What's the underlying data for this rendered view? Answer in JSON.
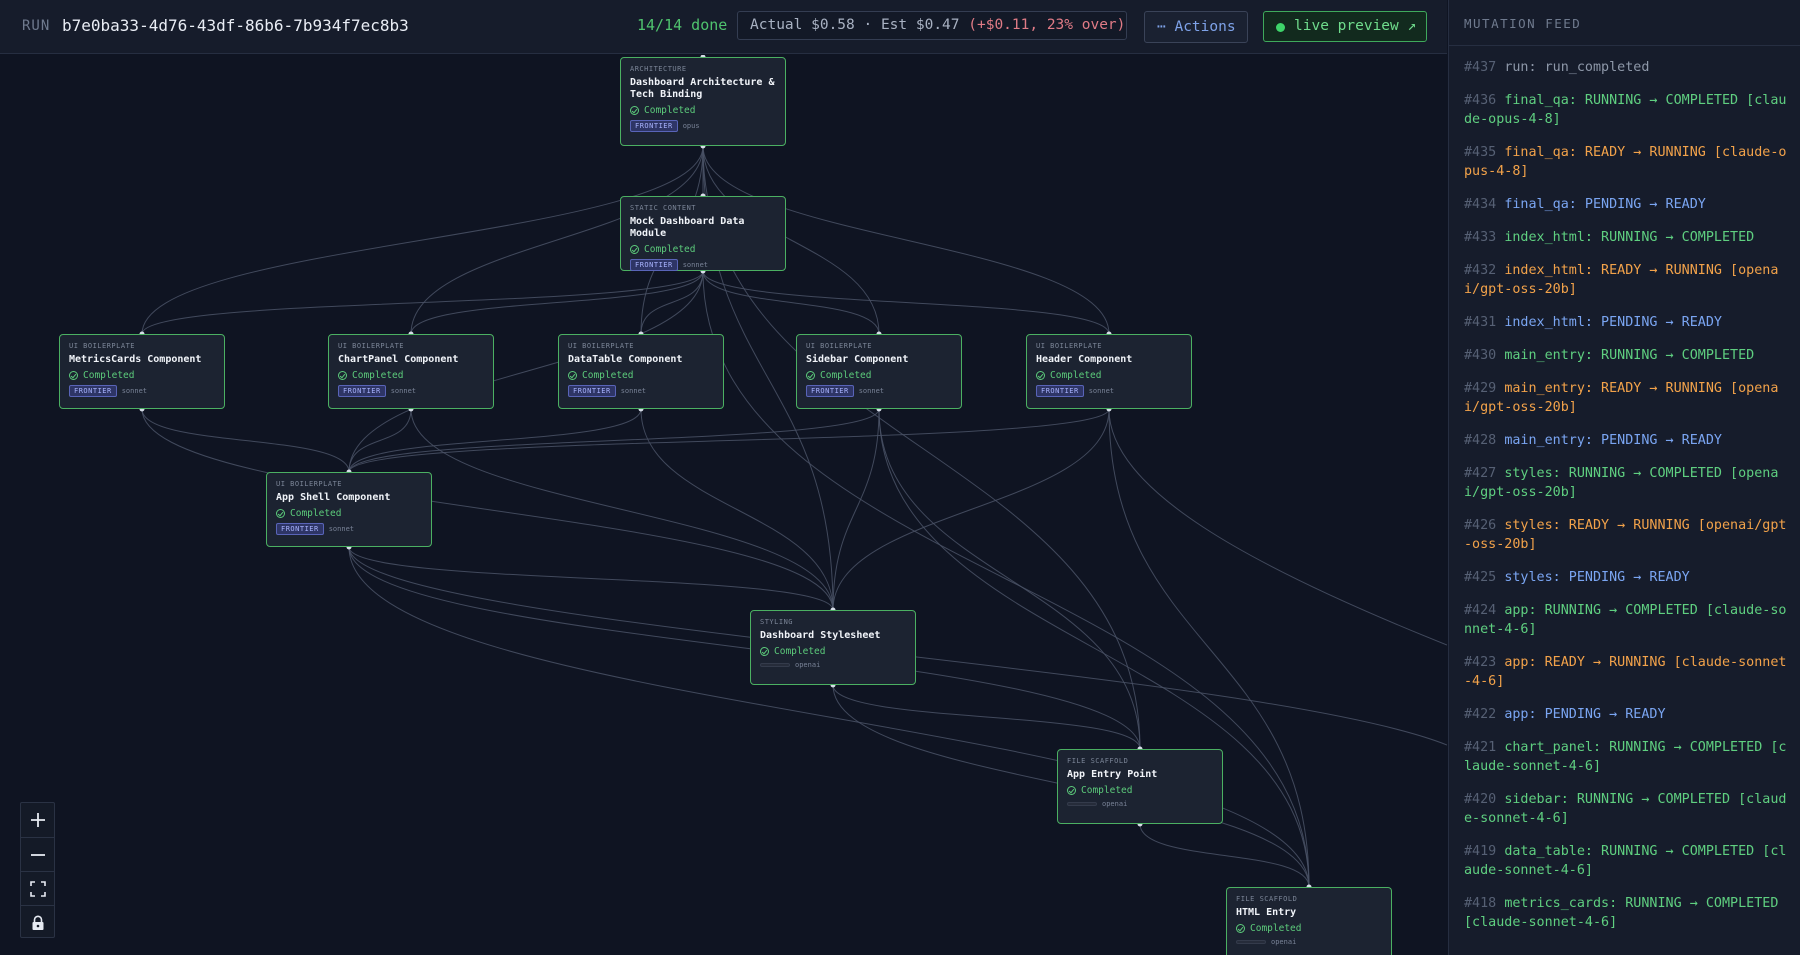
{
  "header": {
    "run_label": "RUN",
    "run_id": "b7e0ba33-4d76-43df-86b6-7b934f7ec8b3",
    "progress": "14/14 done",
    "cost_base": "Actual $0.58 · Est $0.47",
    "cost_over": "(+$0.11, 23% over)",
    "actions_label": "⋯ Actions",
    "live_preview_label": "live preview ↗"
  },
  "nodes": [
    {
      "id": "architecture",
      "category": "ARCHITECTURE",
      "title": "Dashboard Architecture & Tech Binding",
      "status": "Completed",
      "tier": "FRONTIER",
      "model": "opus"
    },
    {
      "id": "mock_data",
      "category": "STATIC CONTENT",
      "title": "Mock Dashboard Data Module",
      "status": "Completed",
      "tier": "FRONTIER",
      "model": "sonnet"
    },
    {
      "id": "metrics_cards",
      "category": "UI BOILERPLATE",
      "title": "MetricsCards Component",
      "status": "Completed",
      "tier": "FRONTIER",
      "model": "sonnet"
    },
    {
      "id": "chart_panel",
      "category": "UI BOILERPLATE",
      "title": "ChartPanel Component",
      "status": "Completed",
      "tier": "FRONTIER",
      "model": "sonnet"
    },
    {
      "id": "data_table",
      "category": "UI BOILERPLATE",
      "title": "DataTable Component",
      "status": "Completed",
      "tier": "FRONTIER",
      "model": "sonnet"
    },
    {
      "id": "sidebar",
      "category": "UI BOILERPLATE",
      "title": "Sidebar Component",
      "status": "Completed",
      "tier": "FRONTIER",
      "model": "sonnet"
    },
    {
      "id": "header",
      "category": "UI BOILERPLATE",
      "title": "Header Component",
      "status": "Completed",
      "tier": "FRONTIER",
      "model": "sonnet"
    },
    {
      "id": "app_shell",
      "category": "UI BOILERPLATE",
      "title": "App Shell Component",
      "status": "Completed",
      "tier": "FRONTIER",
      "model": "sonnet"
    },
    {
      "id": "styles",
      "category": "STYLING",
      "title": "Dashboard Stylesheet",
      "status": "Completed",
      "tier": "",
      "model": "openai"
    },
    {
      "id": "main_entry",
      "category": "FILE SCAFFOLD",
      "title": "App Entry Point",
      "status": "Completed",
      "tier": "",
      "model": "openai"
    },
    {
      "id": "index_html",
      "category": "FILE SCAFFOLD",
      "title": "HTML Entry",
      "status": "Completed",
      "tier": "",
      "model": "openai"
    }
  ],
  "feed": {
    "title": "MUTATION FEED",
    "items": [
      {
        "num": "#437",
        "text": "run: run_completed",
        "color": "gray"
      },
      {
        "num": "#436",
        "text": "final_qa: RUNNING → COMPLETED [claude-opus-4-8]",
        "color": "green"
      },
      {
        "num": "#435",
        "text": "final_qa: READY → RUNNING [claude-opus-4-8]",
        "color": "orange"
      },
      {
        "num": "#434",
        "text": "final_qa: PENDING → READY",
        "color": "blue"
      },
      {
        "num": "#433",
        "text": "index_html: RUNNING → COMPLETED",
        "color": "green"
      },
      {
        "num": "#432",
        "text": "index_html: READY → RUNNING [openai/gpt-oss-20b]",
        "color": "orange"
      },
      {
        "num": "#431",
        "text": "index_html: PENDING → READY",
        "color": "blue"
      },
      {
        "num": "#430",
        "text": "main_entry: RUNNING → COMPLETED",
        "color": "green"
      },
      {
        "num": "#429",
        "text": "main_entry: READY → RUNNING [openai/gpt-oss-20b]",
        "color": "orange"
      },
      {
        "num": "#428",
        "text": "main_entry: PENDING → READY",
        "color": "blue"
      },
      {
        "num": "#427",
        "text": "styles: RUNNING → COMPLETED [openai/gpt-oss-20b]",
        "color": "green"
      },
      {
        "num": "#426",
        "text": "styles: READY → RUNNING [openai/gpt-oss-20b]",
        "color": "orange"
      },
      {
        "num": "#425",
        "text": "styles: PENDING → READY",
        "color": "blue"
      },
      {
        "num": "#424",
        "text": "app: RUNNING → COMPLETED [claude-sonnet-4-6]",
        "color": "green"
      },
      {
        "num": "#423",
        "text": "app: READY → RUNNING [claude-sonnet-4-6]",
        "color": "orange"
      },
      {
        "num": "#422",
        "text": "app: PENDING → READY",
        "color": "blue"
      },
      {
        "num": "#421",
        "text": "chart_panel: RUNNING → COMPLETED [claude-sonnet-4-6]",
        "color": "green"
      },
      {
        "num": "#420",
        "text": "sidebar: RUNNING → COMPLETED [claude-sonnet-4-6]",
        "color": "green"
      },
      {
        "num": "#419",
        "text": "data_table: RUNNING → COMPLETED [claude-sonnet-4-6]",
        "color": "green"
      },
      {
        "num": "#418",
        "text": "metrics_cards: RUNNING → COMPLETED [claude-sonnet-4-6]",
        "color": "green"
      }
    ]
  },
  "colors": {
    "accent_green": "#4bb062",
    "accent_blue": "#7aa5f2",
    "accent_orange": "#f2a24a",
    "over_red": "#e07b86"
  },
  "icons": {
    "zoom_in": "plus-icon",
    "zoom_out": "minus-icon",
    "fit": "fit-view-icon",
    "lock": "lock-icon"
  }
}
